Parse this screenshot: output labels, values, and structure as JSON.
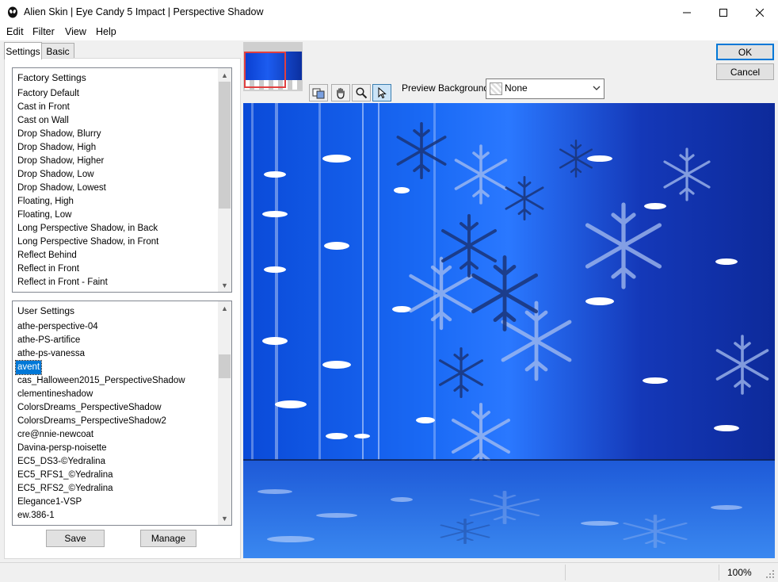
{
  "window": {
    "title": "Alien Skin | Eye Candy 5 Impact | Perspective Shadow"
  },
  "menu": [
    "Edit",
    "Filter",
    "View",
    "Help"
  ],
  "tabs": {
    "settings": "Settings",
    "basic": "Basic"
  },
  "factory": {
    "header": "Factory Settings",
    "items": [
      "Factory Default",
      "Cast in Front",
      "Cast on Wall",
      "Drop Shadow, Blurry",
      "Drop Shadow, High",
      "Drop Shadow, Higher",
      "Drop Shadow, Low",
      "Drop Shadow, Lowest",
      "Floating, High",
      "Floating, Low",
      "Long Perspective Shadow, in Back",
      "Long Perspective Shadow, in Front",
      "Reflect Behind",
      "Reflect in Front",
      "Reflect in Front - Faint"
    ]
  },
  "user": {
    "header": "User Settings",
    "selected": "avent",
    "items": [
      "athe-perspective-04",
      "athe-PS-artifice",
      "athe-ps-vanessa",
      "avent",
      "cas_Halloween2015_PerspectiveShadow",
      "clementineshadow",
      "ColorsDreams_PerspectiveShadow",
      "ColorsDreams_PerspectiveShadow2",
      "cre@nnie-newcoat",
      "Davina-persp-noisette",
      "EC5_DS3-©Yedralina",
      "EC5_RFS1_©Yedralina",
      "EC5_RFS2_©Yedralina",
      "Elegance1-VSP",
      "ew.386-1"
    ]
  },
  "buttons": {
    "save": "Save",
    "manage": "Manage",
    "ok": "OK",
    "cancel": "Cancel"
  },
  "preview": {
    "background_label": "Preview Background:",
    "background_value": "None"
  },
  "status": {
    "zoom": "100%"
  }
}
